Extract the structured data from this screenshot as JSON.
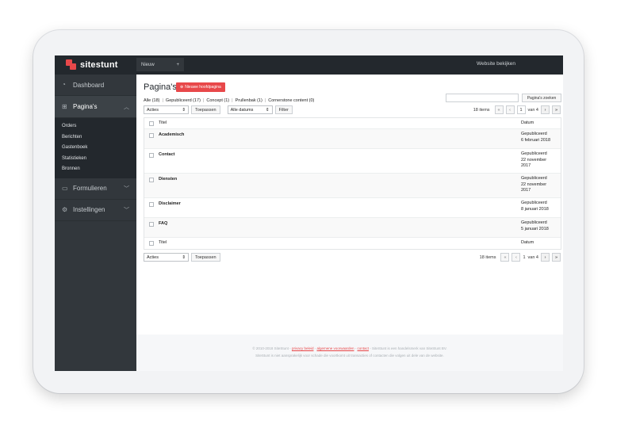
{
  "topbar": {
    "brand": "sitestunt",
    "new_label": "Nieuw",
    "new_plus": "+",
    "view_site": "Website bekijken"
  },
  "sidebar": {
    "items": [
      {
        "label": "Dashboard",
        "icon": "dashboard-icon"
      },
      {
        "label": "Pagina's",
        "icon": "sitemap-icon",
        "chev": "^"
      },
      {
        "label": "Formulieren",
        "icon": "inbox-icon",
        "chev": "v"
      },
      {
        "label": "Instellingen",
        "icon": "gear-icon",
        "chev": "v"
      }
    ],
    "sub": [
      "Orders",
      "Berichten",
      "Gastenboek",
      "Statistieken",
      "Bronnen"
    ]
  },
  "main": {
    "title": "Pagina's",
    "add_button": "Nieuwe hoofdpagina",
    "filters": {
      "all": "Alle (18)",
      "published": "Gepubliceerd (17)",
      "concept": "Concept (1)",
      "trash": "Prullenbak (1)",
      "cornerstone": "Cornerstone content (0)"
    },
    "search_button": "Pagina's zoeken",
    "actions": "Acties",
    "apply": "Toepassen",
    "all_dates": "Alle datums",
    "filter": "Filter",
    "items_count": "18 items",
    "page_num": "1",
    "page_of": "van 4",
    "pager": {
      "first": "«",
      "prev": "‹",
      "next": "›",
      "last": "»"
    },
    "columns": {
      "title": "Titel",
      "date": "Datum"
    },
    "rows": [
      {
        "title": "Academisch",
        "status": "Gepubliceerd",
        "date1": "6 februari 2018",
        "date2": ""
      },
      {
        "title": "Contact",
        "status": "Gepubliceerd",
        "date1": "22 november",
        "date2": "2017"
      },
      {
        "title": "Diensten",
        "status": "Gepubliceerd",
        "date1": "22 november",
        "date2": "2017"
      },
      {
        "title": "Disclaimer",
        "status": "Gepubliceerd",
        "date1": "8 januari 2018",
        "date2": ""
      },
      {
        "title": "FAQ",
        "status": "Gepubliceerd",
        "date1": "5 januari 2018",
        "date2": ""
      }
    ]
  },
  "footer": {
    "line1_pre": "© 2010-2018 SiteStunt -",
    "privacy": "privacy beleid",
    "terms": "algemene voorwaarden",
    "contact": "contact",
    "line1_post": "- SiteStunt is een handelsmerk van SiteStunt BV.",
    "line2": "SiteStunt is niet aansprakelijk voor schade die voortkomt uit transacties of contacten die volgen uit dele van de website."
  },
  "colors": {
    "accent": "#e8484a",
    "topbar": "#23282d",
    "sidebar": "#32373c"
  }
}
